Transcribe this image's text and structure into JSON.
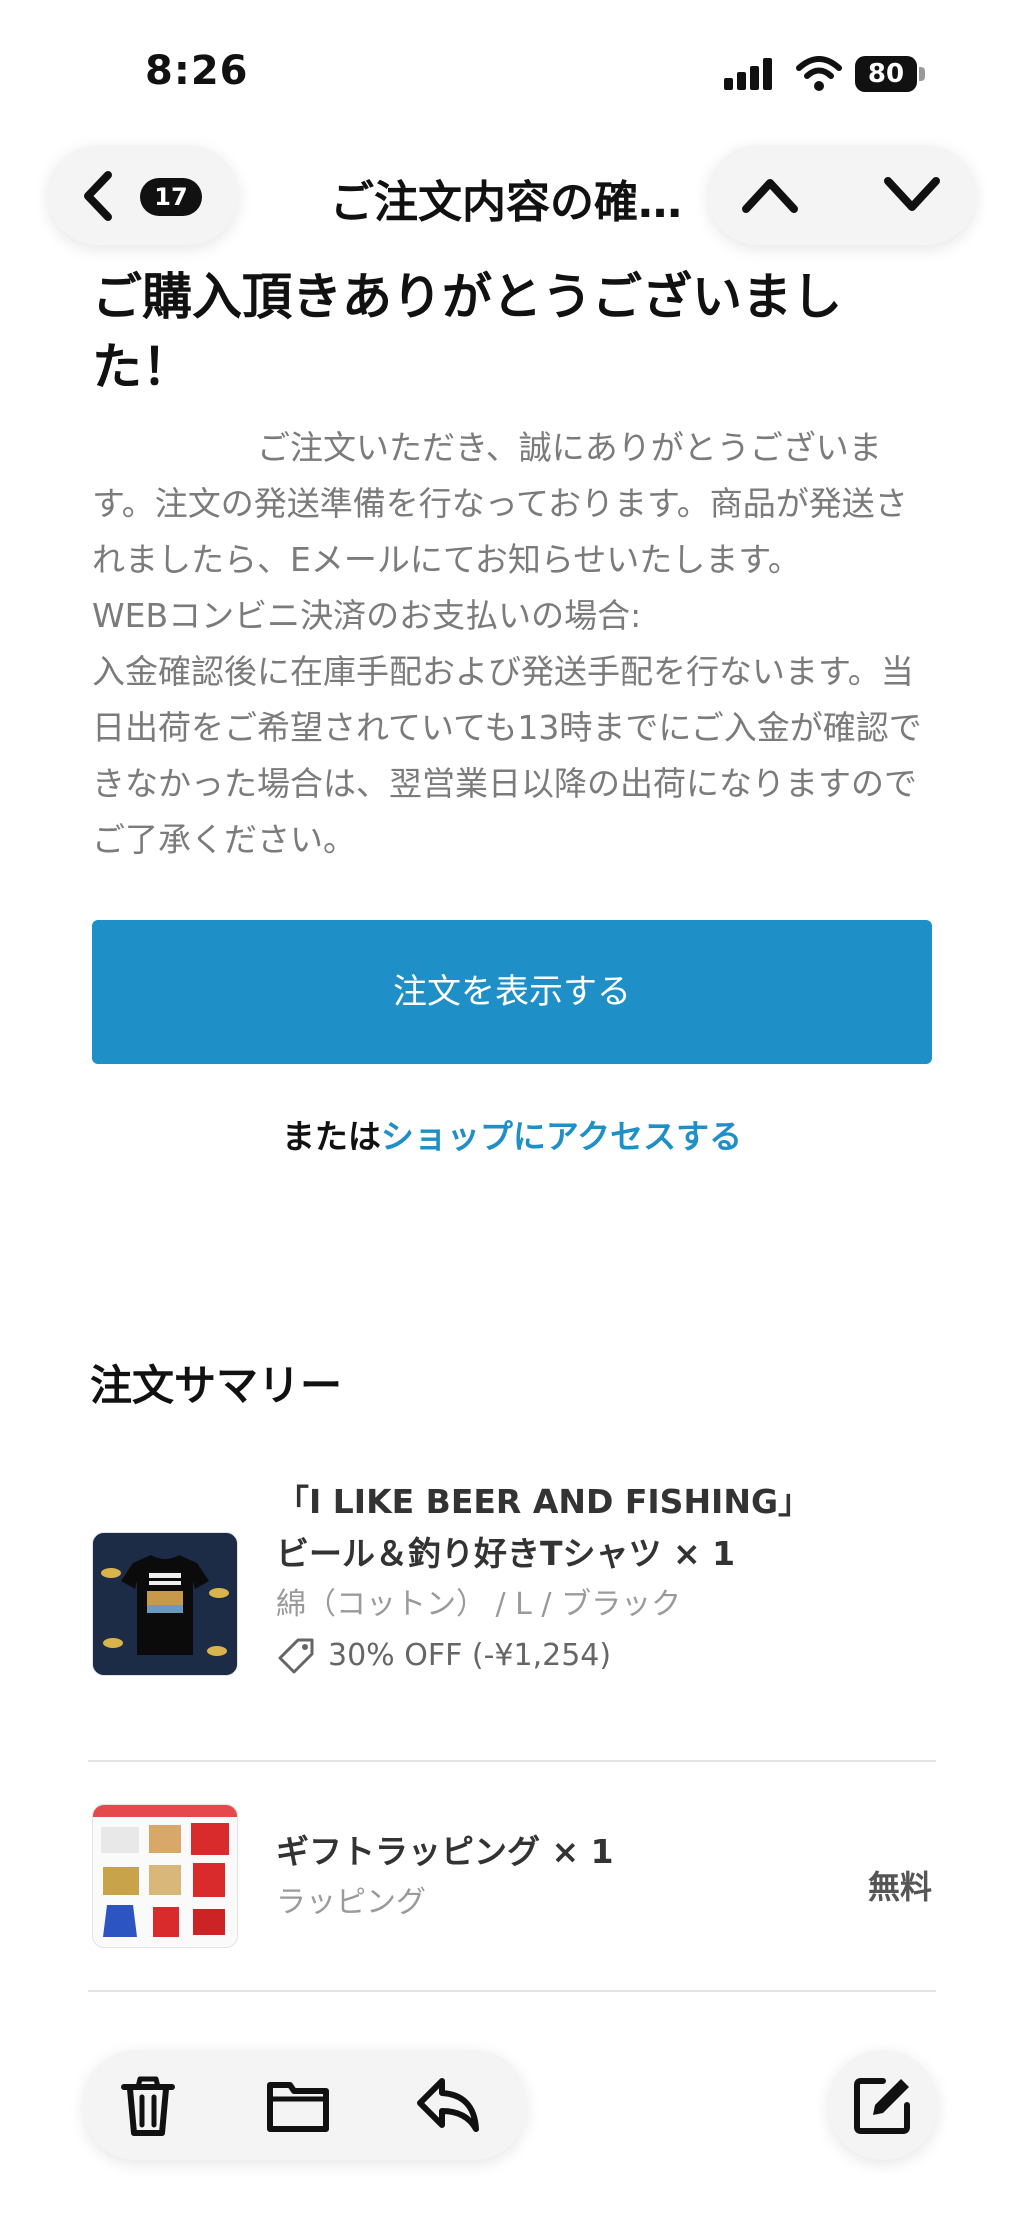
{
  "status_bar": {
    "time": "8:26",
    "battery": "80"
  },
  "nav": {
    "badge": "17",
    "title": "ご注文内容の確…"
  },
  "email": {
    "heading": "ご購入頂きありがとうございました！",
    "body": "　　　　　ご注文いただき、誠にありがとうございます。注文の発送準備を行なっております。商品が発送されましたら、Eメールにてお知らせいたします。\nWEBコンビニ決済のお支払いの場合:\n入金確認後に在庫手配および発送手配を行ないます。当日出荷をご希望されていても13時までにご入金が確認できなかった場合は、翌営業日以降の出荷になりますのでご了承ください。",
    "cta_label": "注文を表示する",
    "or_prefix": "または",
    "shop_link": "ショップにアクセスする"
  },
  "summary": {
    "title": "注文サマリー",
    "items": [
      {
        "name": "「I LIKE BEER AND FISHING」ビール＆釣り好きTシャツ × 1",
        "variant": "綿（コットン） / L / ブラック",
        "discount": "30% OFF (-¥1,254)",
        "icon": "tag-icon"
      },
      {
        "name": "ギフトラッピング × 1",
        "variant": "ラッピング",
        "price": "無料"
      }
    ]
  },
  "toolbar": {
    "icons": [
      "trash-icon",
      "folder-icon",
      "reply-icon",
      "compose-icon"
    ]
  },
  "colors": {
    "accent": "#1f8fc7",
    "text": "#111111",
    "muted": "#7b7b7b"
  }
}
